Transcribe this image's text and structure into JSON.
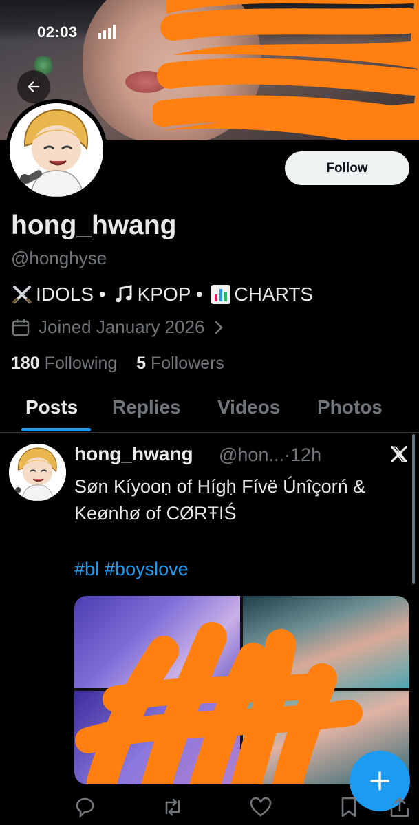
{
  "status_bar": {
    "time": "02:03"
  },
  "profile": {
    "follow_label": "Follow",
    "display_name": "hong_hwang",
    "handle": "@honghyse",
    "bio_parts": [
      "IDOLS •",
      "KPOP •",
      "CHARTS"
    ],
    "joined": "Joined January 2026",
    "following_count": "180",
    "following_label": "Following",
    "followers_count": "5",
    "followers_label": "Followers"
  },
  "tabs": [
    {
      "label": "Posts",
      "selected": true
    },
    {
      "label": "Replies",
      "selected": false
    },
    {
      "label": "Videos",
      "selected": false
    },
    {
      "label": "Photos",
      "selected": false
    }
  ],
  "post": {
    "author_name": "hong_hwang",
    "author_handle": "@hon...",
    "time": "12h",
    "text": "Søn Kíyooṇ of Hígḥ Fívë Únîçorń & Keønhø of CØRŦIŚ",
    "hashtags": [
      "#bl",
      "#boyslove"
    ]
  },
  "colors": {
    "accent": "#1d9bf0",
    "background": "#000000",
    "muted": "#71767b",
    "redaction": "#ff7f11"
  },
  "icons": [
    "back-arrow-icon",
    "calendar-icon",
    "chevron-right-icon",
    "x-logo-icon",
    "plus-icon",
    "reply-icon",
    "repost-icon",
    "like-icon",
    "bookmark-icon",
    "share-icon"
  ]
}
